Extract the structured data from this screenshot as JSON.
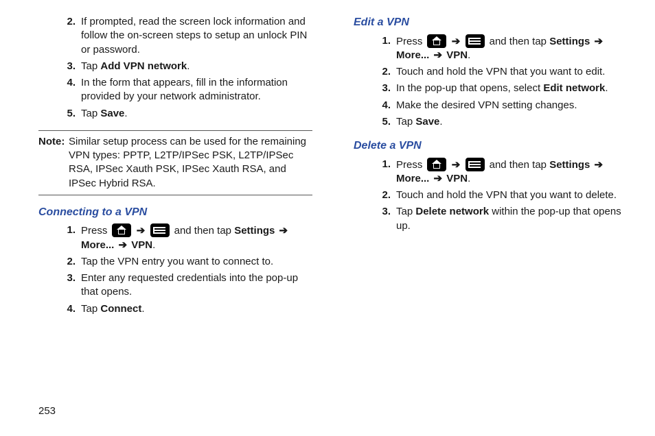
{
  "pageNumber": "253",
  "arrow": "➔",
  "col1": {
    "items1": [
      {
        "num": "2.",
        "text_a": "If prompted, read the screen lock information and follow the on-screen steps to setup an unlock PIN or password."
      },
      {
        "num": "3.",
        "text_a": "Tap ",
        "bold_a": "Add VPN network",
        "text_b": "."
      },
      {
        "num": "4.",
        "text_a": "In the form that appears, fill in the information provided by your network administrator."
      },
      {
        "num": "5.",
        "text_a": "Tap ",
        "bold_a": "Save",
        "text_b": "."
      }
    ],
    "note": {
      "label": "Note:",
      "text": "Similar setup process can be used for the remaining VPN types: PPTP, L2TP/IPSec PSK, L2TP/IPSec RSA, IPSec Xauth PSK, IPSec Xauth RSA, and IPSec Hybrid RSA."
    },
    "heading1": "Connecting to a VPN",
    "nav": {
      "num": "1.",
      "press": "Press ",
      "andthen": " and then tap ",
      "b1": "Settings",
      "b2": "More...",
      "b3": "VPN",
      "dot": "."
    },
    "items2": [
      {
        "num": "2.",
        "text_a": "Tap the VPN entry you want to connect to."
      },
      {
        "num": "3.",
        "text_a": "Enter any requested credentials into the pop-up that opens."
      },
      {
        "num": "4.",
        "text_a": "Tap ",
        "bold_a": "Connect",
        "text_b": "."
      }
    ]
  },
  "col2": {
    "heading1": "Edit a VPN",
    "nav1": {
      "num": "1.",
      "press": "Press ",
      "andthen": " and then tap ",
      "b1": "Settings",
      "b2": "More...",
      "b3": "VPN",
      "dot": "."
    },
    "items1": [
      {
        "num": "2.",
        "text_a": "Touch and hold the VPN that you want to edit."
      },
      {
        "num": "3.",
        "text_a": "In the pop-up that opens, select ",
        "bold_a": "Edit network",
        "text_b": "."
      },
      {
        "num": "4.",
        "text_a": "Make the desired VPN setting changes."
      },
      {
        "num": "5.",
        "text_a": "Tap ",
        "bold_a": "Save",
        "text_b": "."
      }
    ],
    "heading2": "Delete a VPN",
    "nav2": {
      "num": "1.",
      "press": "Press ",
      "andthen": " and then tap ",
      "b1": "Settings",
      "b2": "More...",
      "b3": "VPN",
      "dot": "."
    },
    "items2": [
      {
        "num": "2.",
        "text_a": "Touch and hold the VPN that you want to delete."
      },
      {
        "num": "3.",
        "text_a": "Tap ",
        "bold_a": "Delete network",
        "text_b": " within the pop-up that opens up."
      }
    ]
  }
}
